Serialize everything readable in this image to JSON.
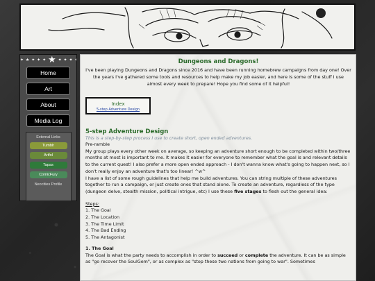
{
  "nav": {
    "stars_left": "✦ ★ ✦ ✦ ✦",
    "star_center": "★",
    "stars_right": "✦ ✦ ✦ ✦ ✦",
    "items": [
      {
        "label": "Home"
      },
      {
        "label": "Art"
      },
      {
        "label": "About"
      },
      {
        "label": "Media Log"
      }
    ]
  },
  "external": {
    "title": "External Links",
    "links": [
      {
        "label": "Tumblr",
        "color": "#8a9a3a"
      },
      {
        "label": "Artfol",
        "color": "#6a8a3a"
      },
      {
        "label": "Tapas",
        "color": "#2f7a3a"
      },
      {
        "label": "ComicFury",
        "color": "#4a8a5a"
      }
    ],
    "footer": "Neocities Profile"
  },
  "main": {
    "title": "Dungeons and Dragons!",
    "intro": "I've been playing Dungeons and Dragons since 2016 and have been running homebrew campaigns from day one! Over the years I've gathered some tools and resources to help make my job easier, and here is some of the stuff I use almost every week to prepare! Hope you find some of it helpful!",
    "index": {
      "title": "Index",
      "link": "5-step Adventure Design"
    }
  },
  "article": {
    "title": "5-step Adventure Design",
    "subtitle": "This is a step-by-step process I use to create short, open ended adventures.",
    "preramble_label": "Pre-ramble",
    "para1": "My group plays every other week on average, so keeping an adventure short enough to be completed within two/three months at most is important to me. It makes it easier for everyone to remember what the goal is and relevant details to the current quest! I also prefer a more open ended approach - I don't wanna know what's going to happen next, so I don't really enjoy an adventure that's too linear! ^w^",
    "para2_a": "I have a list of some rough guidelines that help me build adventures. You can string multiple of these adventures together to run a campaign, or just create ones that stand alone. To create an adventure, regardless of the type (dungeon delve, stealth mission, political intrigue, etc) I use these ",
    "para2_b": "five stages",
    "para2_c": " to flesh out the general idea:",
    "steps_label": "Steps:",
    "steps": [
      "1. The Goal",
      "2. The Location",
      "3. The Time Limit",
      "4. The Bad Ending",
      "5. The Antagonist"
    ],
    "goal_heading": "1. The Goal",
    "goal_a": "The Goal is what the party needs to accomplish in order to ",
    "goal_b": "succeed",
    "goal_c": " or ",
    "goal_d": "complete",
    "goal_e": " the adventure. It can be as simple as \"go recover the SoulGem\", or as complex as \"stop these two nations from going to war\". Sometimes"
  }
}
